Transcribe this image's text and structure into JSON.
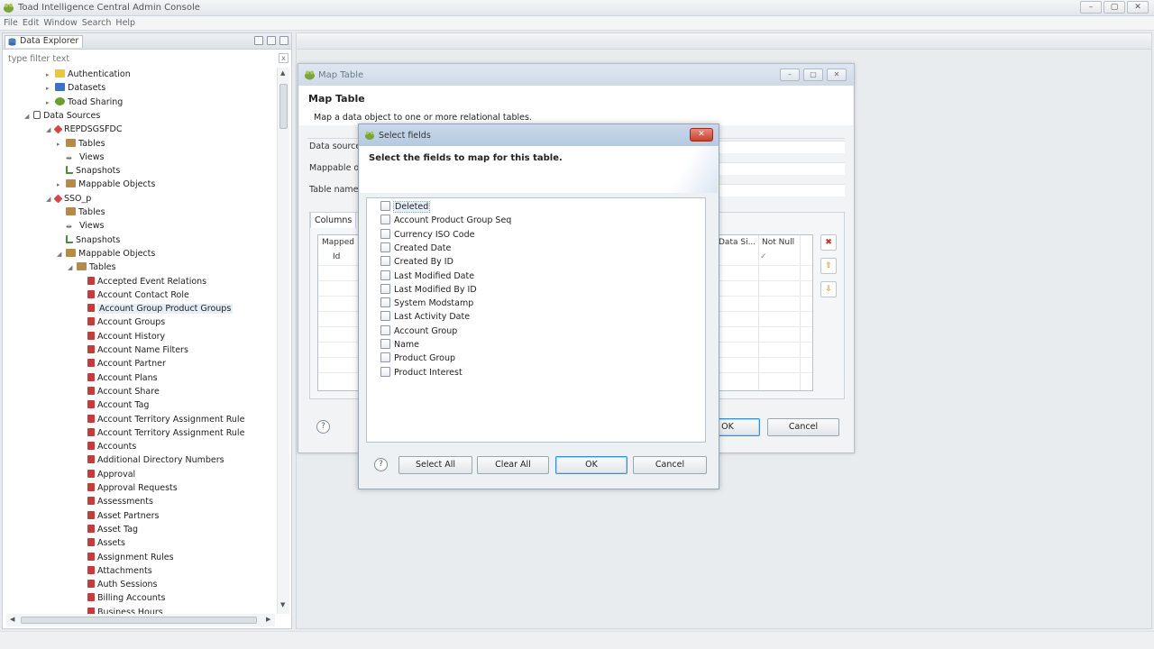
{
  "window": {
    "title": "Toad Intelligence Central Admin Console",
    "controls": [
      "–",
      "▢",
      "✕"
    ]
  },
  "menubar": [
    "File",
    "Edit",
    "Window",
    "Search",
    "Help"
  ],
  "explorer": {
    "tab_label": "Data Explorer",
    "filter_placeholder": "type filter text",
    "tree": [
      {
        "label": "Authentication",
        "depth": 2,
        "icon": "auth",
        "twisty": "▸"
      },
      {
        "label": "Datasets",
        "depth": 2,
        "icon": "ds",
        "twisty": "▸"
      },
      {
        "label": "Toad Sharing",
        "depth": 2,
        "icon": "share",
        "twisty": "▸"
      },
      {
        "label": "Data Sources",
        "depth": 1,
        "icon": "db",
        "twisty": "◢"
      },
      {
        "label": "REPDSGSFDC",
        "depth": 2,
        "icon": "srv",
        "twisty": "◢"
      },
      {
        "label": "Tables",
        "depth": 3,
        "icon": "folder",
        "twisty": "▸"
      },
      {
        "label": "Views",
        "depth": 3,
        "icon": "views",
        "twisty": ""
      },
      {
        "label": "Snapshots",
        "depth": 3,
        "icon": "snap",
        "twisty": ""
      },
      {
        "label": "Mappable Objects",
        "depth": 3,
        "icon": "folder",
        "twisty": "▸"
      },
      {
        "label": "SSO_p",
        "depth": 2,
        "icon": "srv",
        "twisty": "◢"
      },
      {
        "label": "Tables",
        "depth": 3,
        "icon": "folder",
        "twisty": ""
      },
      {
        "label": "Views",
        "depth": 3,
        "icon": "views",
        "twisty": ""
      },
      {
        "label": "Snapshots",
        "depth": 3,
        "icon": "snap",
        "twisty": ""
      },
      {
        "label": "Mappable Objects",
        "depth": 3,
        "icon": "folder",
        "twisty": "◢"
      },
      {
        "label": "Tables",
        "depth": 4,
        "icon": "folder",
        "twisty": "◢"
      },
      {
        "label": "Accepted Event Relations",
        "depth": 5,
        "icon": "table",
        "twisty": ""
      },
      {
        "label": "Account Contact Role",
        "depth": 5,
        "icon": "table",
        "twisty": ""
      },
      {
        "label": "Account Group Product Groups",
        "depth": 5,
        "icon": "table",
        "twisty": "",
        "selected": true
      },
      {
        "label": "Account Groups",
        "depth": 5,
        "icon": "table",
        "twisty": ""
      },
      {
        "label": "Account History",
        "depth": 5,
        "icon": "table",
        "twisty": ""
      },
      {
        "label": "Account Name Filters",
        "depth": 5,
        "icon": "table",
        "twisty": ""
      },
      {
        "label": "Account Partner",
        "depth": 5,
        "icon": "table",
        "twisty": ""
      },
      {
        "label": "Account Plans",
        "depth": 5,
        "icon": "table",
        "twisty": ""
      },
      {
        "label": "Account Share",
        "depth": 5,
        "icon": "table",
        "twisty": ""
      },
      {
        "label": "Account Tag",
        "depth": 5,
        "icon": "table",
        "twisty": ""
      },
      {
        "label": "Account Territory Assignment Rule",
        "depth": 5,
        "icon": "table",
        "twisty": ""
      },
      {
        "label": "Account Territory Assignment Rule",
        "depth": 5,
        "icon": "table",
        "twisty": ""
      },
      {
        "label": "Accounts",
        "depth": 5,
        "icon": "table",
        "twisty": ""
      },
      {
        "label": "Additional Directory Numbers",
        "depth": 5,
        "icon": "table",
        "twisty": ""
      },
      {
        "label": "Approval",
        "depth": 5,
        "icon": "table",
        "twisty": ""
      },
      {
        "label": "Approval Requests",
        "depth": 5,
        "icon": "table",
        "twisty": ""
      },
      {
        "label": "Assessments",
        "depth": 5,
        "icon": "table",
        "twisty": ""
      },
      {
        "label": "Asset Partners",
        "depth": 5,
        "icon": "table",
        "twisty": ""
      },
      {
        "label": "Asset Tag",
        "depth": 5,
        "icon": "table",
        "twisty": ""
      },
      {
        "label": "Assets",
        "depth": 5,
        "icon": "table",
        "twisty": ""
      },
      {
        "label": "Assignment Rules",
        "depth": 5,
        "icon": "table",
        "twisty": ""
      },
      {
        "label": "Attachments",
        "depth": 5,
        "icon": "table",
        "twisty": ""
      },
      {
        "label": "Auth Sessions",
        "depth": 5,
        "icon": "table",
        "twisty": ""
      },
      {
        "label": "Billing Accounts",
        "depth": 5,
        "icon": "table",
        "twisty": ""
      },
      {
        "label": "Business Hours",
        "depth": 5,
        "icon": "table",
        "twisty": ""
      }
    ]
  },
  "map_table": {
    "title": "Map Table",
    "heading": "Map Table",
    "description": "Map a data object to one or more relational tables.",
    "labels": {
      "data_source": "Data source",
      "mappable": "Mappable o",
      "table_name": "Table name"
    },
    "columns_tab": "Columns",
    "grid_headers": {
      "mapped": "Mapped",
      "data_size": "Data Si...",
      "not_null": "Not Null"
    },
    "grid_row": {
      "name": "Id",
      "not_null": "✓"
    },
    "side_buttons": [
      "✖",
      "⇧",
      "⇩"
    ],
    "buttons": {
      "ok": "OK",
      "cancel": "Cancel"
    }
  },
  "select_fields": {
    "title": "Select fields",
    "heading": "Select the fields to map for this table.",
    "fields": [
      {
        "label": "Deleted",
        "checked": false
      },
      {
        "label": "Account Product Group Seq",
        "checked": false
      },
      {
        "label": "Currency ISO Code",
        "checked": false
      },
      {
        "label": "Created Date",
        "checked": false
      },
      {
        "label": "Created By ID",
        "checked": false
      },
      {
        "label": "Last Modified Date",
        "checked": false
      },
      {
        "label": "Last Modified By ID",
        "checked": false
      },
      {
        "label": "System Modstamp",
        "checked": false
      },
      {
        "label": "Last Activity Date",
        "checked": false
      },
      {
        "label": "Account Group",
        "checked": false
      },
      {
        "label": "Name",
        "checked": false
      },
      {
        "label": "Product Group",
        "checked": false
      },
      {
        "label": "Product Interest",
        "checked": false
      }
    ],
    "buttons": {
      "select_all": "Select All",
      "clear_all": "Clear All",
      "ok": "OK",
      "cancel": "Cancel"
    }
  },
  "colors": {
    "accent": "#3c8fd6",
    "close": "#c8412d",
    "selection": "#e6eef7"
  }
}
